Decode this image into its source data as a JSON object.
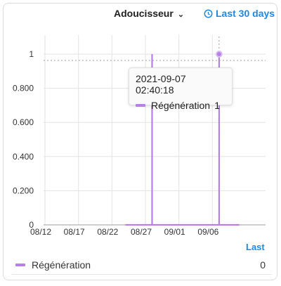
{
  "header": {
    "entity_label": "Adoucisseur",
    "range_label": "Last 30 days",
    "clock_icon": "clock-icon",
    "chevron_icon": "chevron-down-icon"
  },
  "tooltip": {
    "datetime": "2021-09-07 02:40:18",
    "series_name": "Régénération",
    "value": "1"
  },
  "legend": {
    "column_header": "Last",
    "rows": [
      {
        "name": "Régénération",
        "value": "0",
        "color": "#b87fe6"
      }
    ]
  },
  "chart_data": {
    "type": "line",
    "x_tick_labels": [
      "08/12",
      "08/17",
      "08/22",
      "08/27",
      "09/01",
      "09/06"
    ],
    "y_tick_labels": [
      "0",
      "0.200",
      "0.400",
      "0.600",
      "0.800",
      "1"
    ],
    "ylim": [
      0,
      1
    ],
    "grid": true,
    "series": [
      {
        "name": "Régénération",
        "color": "#b87fe6",
        "points": [
          {
            "x": "2021-08-24",
            "y": 0
          },
          {
            "x": "2021-08-28",
            "y": 0
          },
          {
            "x": "2021-08-28",
            "y": 1
          },
          {
            "x": "2021-08-28",
            "y": 0
          },
          {
            "x": "2021-09-07",
            "y": 0
          },
          {
            "x": "2021-09-07",
            "y": 1
          },
          {
            "x": "2021-09-07",
            "y": 0
          },
          {
            "x": "2021-09-10",
            "y": 0
          }
        ]
      }
    ],
    "hover_x": "2021-09-07",
    "hover_y": 1
  }
}
